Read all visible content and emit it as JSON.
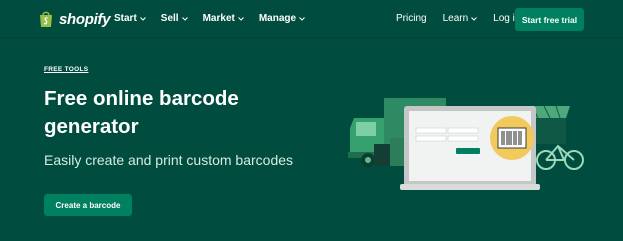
{
  "nav": {
    "logo_text": "shopify",
    "menu": [
      {
        "label": "Start"
      },
      {
        "label": "Sell"
      },
      {
        "label": "Market"
      },
      {
        "label": "Manage"
      }
    ],
    "right_links": [
      {
        "label": "Pricing"
      },
      {
        "label": "Learn"
      },
      {
        "label": "Log in"
      }
    ],
    "cta_label": "Start free trial"
  },
  "hero": {
    "eyebrow": "FREE TOOLS",
    "title": "Free online barcode generator",
    "subtitle": "Easily create and print custom barcodes",
    "cta_label": "Create a barcode"
  },
  "colors": {
    "background": "#004c3f",
    "accent": "#008060",
    "barcode_circle": "#f1c95d"
  }
}
